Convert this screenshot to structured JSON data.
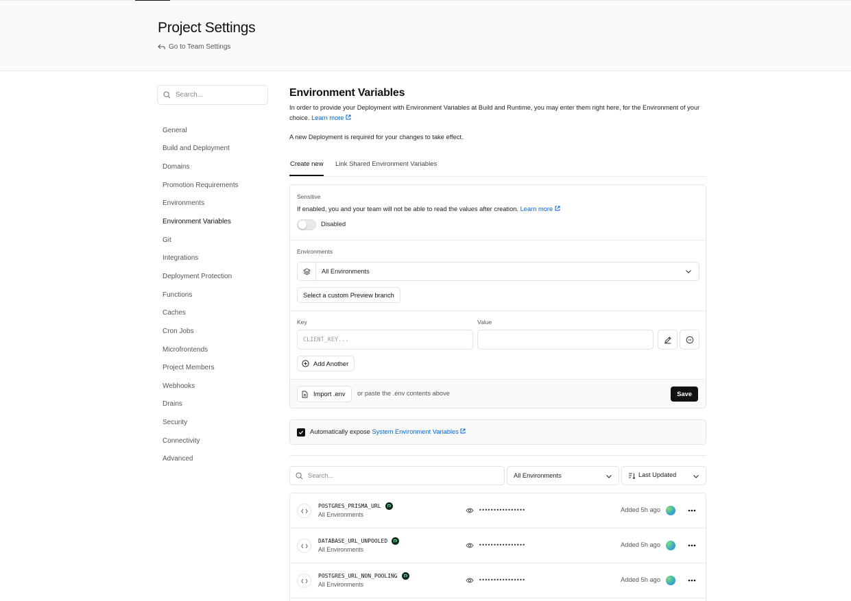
{
  "header": {
    "title": "Project Settings",
    "back_link": "Go to Team Settings"
  },
  "sidebar": {
    "search_placeholder": "Search...",
    "items": [
      {
        "label": "General"
      },
      {
        "label": "Build and Deployment"
      },
      {
        "label": "Domains"
      },
      {
        "label": "Promotion Requirements"
      },
      {
        "label": "Environments"
      },
      {
        "label": "Environment Variables",
        "active": true
      },
      {
        "label": "Git"
      },
      {
        "label": "Integrations"
      },
      {
        "label": "Deployment Protection"
      },
      {
        "label": "Functions"
      },
      {
        "label": "Caches"
      },
      {
        "label": "Cron Jobs"
      },
      {
        "label": "Microfrontends"
      },
      {
        "label": "Project Members"
      },
      {
        "label": "Webhooks"
      },
      {
        "label": "Drains"
      },
      {
        "label": "Security"
      },
      {
        "label": "Connectivity"
      },
      {
        "label": "Advanced"
      }
    ]
  },
  "main": {
    "title": "Environment Variables",
    "description": "In order to provide your Deployment with Environment Variables at Build and Runtime, you may enter them right here, for the Environment of your choice.",
    "learn_more": "Learn more",
    "note": "A new Deployment is required for your changes to take effect.",
    "tabs": [
      {
        "label": "Create new",
        "active": true
      },
      {
        "label": "Link Shared Environment Variables"
      }
    ]
  },
  "form": {
    "sensitive_label": "Sensitive",
    "sensitive_desc": "If enabled, you and your team will not be able to read the values after creation.",
    "learn_more": "Learn more",
    "toggle_label": "Disabled",
    "environments_label": "Environments",
    "environments_value": "All Environments",
    "custom_branch_button": "Select a custom Preview branch",
    "key_label": "Key",
    "key_placeholder": "CLIENT_KEY...",
    "value_label": "Value",
    "value_placeholder": "",
    "add_another": "Add Another",
    "import_button": "Import .env",
    "paste_hint": "or paste the .env contents above",
    "save_button": "Save"
  },
  "expose": {
    "checked": true,
    "label": "Automatically expose",
    "link": "System Environment Variables"
  },
  "list": {
    "search_placeholder": "Search...",
    "env_filter": "All Environments",
    "sort": "Last Updated",
    "rows": [
      {
        "key": "POSTGRES_PRISMA_URL",
        "env": "All Environments",
        "masked": "••••••••••••••••",
        "added": "Added 5h ago"
      },
      {
        "key": "DATABASE_URL_UNPOOLED",
        "env": "All Environments",
        "masked": "••••••••••••••••",
        "added": "Added 5h ago"
      },
      {
        "key": "POSTGRES_URL_NON_POOLING",
        "env": "All Environments",
        "masked": "••••••••••••••••",
        "added": "Added 5h ago"
      }
    ]
  },
  "colors": {
    "accent_link": "#0067d6",
    "primary_button": "#111111",
    "integration_badge": "#0d2d1a"
  }
}
